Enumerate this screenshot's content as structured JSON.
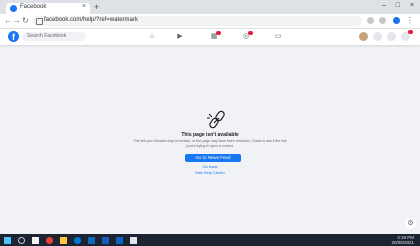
{
  "browser": {
    "tab_title": "Facebook",
    "url": "facebook.com/help/?ref=watermark"
  },
  "facebook": {
    "search_placeholder": "Search Facebook"
  },
  "content": {
    "heading": "This page isn't available",
    "description": "The link you followed may be broken, or the page may have been removed. Check to see if the link you're trying to open is correct.",
    "primary_button": "Go to News Feed",
    "back_link": "Go back",
    "help_link": "Visit Help Center"
  },
  "taskbar": {
    "time": "3:19 PM",
    "date": "20/05/2021"
  },
  "colors": {
    "fb_blue": "#1877f2",
    "page_bg": "#f0f2f5"
  }
}
